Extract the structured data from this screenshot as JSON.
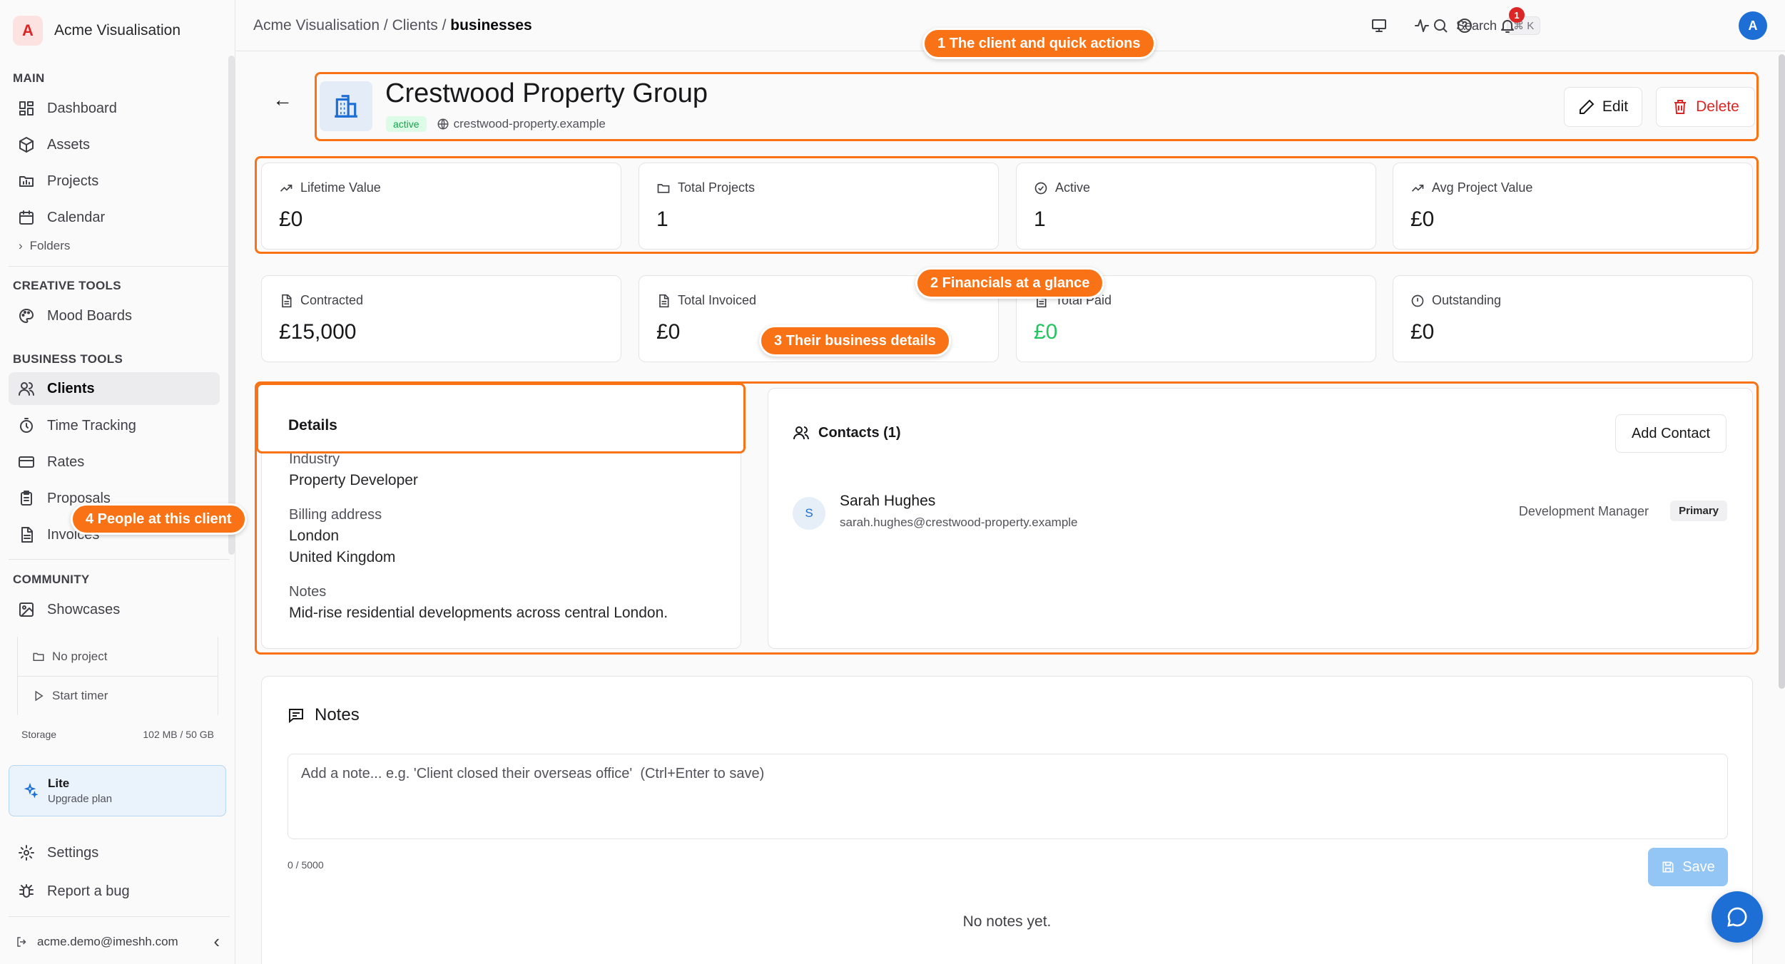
{
  "app": {
    "name": "Acme Visualisation",
    "logo_letter": "A"
  },
  "sidebar": {
    "sections": {
      "main": "MAIN",
      "creative": "CREATIVE TOOLS",
      "business": "BUSINESS TOOLS",
      "community": "COMMUNITY"
    },
    "items": {
      "dashboard": "Dashboard",
      "assets": "Assets",
      "projects": "Projects",
      "calendar": "Calendar",
      "folders": "Folders",
      "mood_boards": "Mood Boards",
      "clients": "Clients",
      "time_tracking": "Time Tracking",
      "rates": "Rates",
      "proposals": "Proposals",
      "invoices": "Invoices",
      "showcases": "Showcases",
      "settings": "Settings",
      "report_bug": "Report a bug"
    },
    "timer": {
      "project": "No project",
      "start": "Start timer"
    },
    "storage": {
      "label": "Storage",
      "value": "102 MB / 50 GB"
    },
    "plan": {
      "name": "Lite",
      "cta": "Upgrade plan"
    },
    "user_email": "acme.demo@imeshh.com"
  },
  "topbar": {
    "breadcrumb": {
      "root": "Acme Visualisation",
      "sep": " / ",
      "parent": "Clients",
      "current": "businesses"
    },
    "search_label": "Search",
    "search_shortcut": "⌘ K",
    "notifications_count": "1",
    "user_initial": "A"
  },
  "client": {
    "name": "Crestwood Property Group",
    "status": "active",
    "website": "crestwood-property.example",
    "edit_label": "Edit",
    "delete_label": "Delete"
  },
  "stats": [
    {
      "label": "Lifetime Value",
      "value": "£0",
      "icon": "trending-up-icon"
    },
    {
      "label": "Total Projects",
      "value": "1",
      "icon": "folder-icon"
    },
    {
      "label": "Active",
      "value": "1",
      "icon": "check-circle-icon"
    },
    {
      "label": "Avg Project Value",
      "value": "£0",
      "icon": "trending-up-icon"
    },
    {
      "label": "Contracted",
      "value": "£15,000",
      "icon": "document-icon"
    },
    {
      "label": "Total Invoiced",
      "value": "£0",
      "icon": "document-icon"
    },
    {
      "label": "Total Paid",
      "value": "£0",
      "icon": "document-icon"
    },
    {
      "label": "Outstanding",
      "value": "£0",
      "icon": "alert-circle-icon"
    }
  ],
  "details": {
    "title": "Details",
    "industry_label": "Industry",
    "industry": "Property Developer",
    "billing_label": "Billing address",
    "billing_line1": "London",
    "billing_line2": "United Kingdom",
    "notes_label": "Notes",
    "notes": "Mid-rise residential developments across central London."
  },
  "contacts": {
    "title": "Contacts (1)",
    "add_label": "Add Contact",
    "items": [
      {
        "initial": "S",
        "name": "Sarah Hughes",
        "email": "sarah.hughes@crestwood-property.example",
        "role": "Development Manager",
        "badge": "Primary"
      }
    ]
  },
  "notes": {
    "title": "Notes",
    "placeholder": "Add a note... e.g. 'Client closed their overseas office'  (Ctrl+Enter to save)",
    "char_count": "0 / 5000",
    "save_label": "Save",
    "empty": "No notes yet."
  },
  "annotations": {
    "a1": "1 The client and quick actions",
    "a2": "2 Financials at a glance",
    "a3": "3 Their business details",
    "a4": "4 People at this client"
  },
  "colors": {
    "accent": "#1d6fd6",
    "annotation": "#f97316",
    "danger": "#dc2626",
    "success": "#22c55e"
  }
}
